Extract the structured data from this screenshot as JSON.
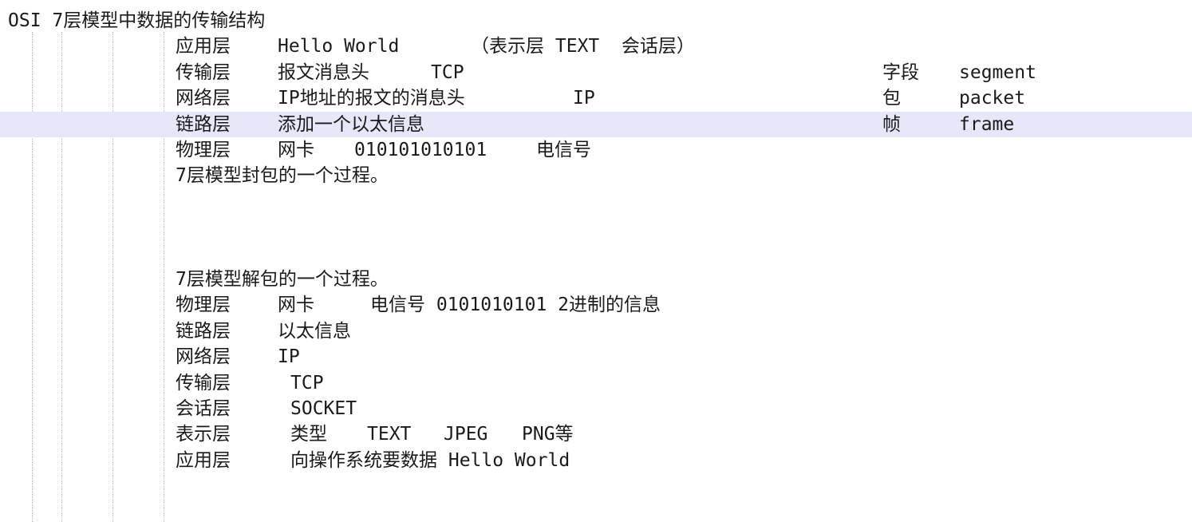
{
  "editor": {
    "title": "OSI 7层模型中数据的传输结构",
    "highlight_row": 4,
    "lines": [
      {
        "segments": [
          "OSI 7层模型中数据的传输结构"
        ]
      },
      {
        "segments": [
          "应用层",
          "Hello World",
          "（表示层 TEXT  会话层）"
        ]
      },
      {
        "segments": [
          "传输层",
          "报文消息头",
          "TCP",
          "字段",
          "segment"
        ]
      },
      {
        "segments": [
          "网络层",
          "IP地址的报文的消息头",
          "IP",
          "包",
          "packet"
        ]
      },
      {
        "segments": [
          "链路层",
          "添加一个以太信息",
          "帧",
          "frame"
        ]
      },
      {
        "segments": [
          "物理层",
          "网卡",
          "010101010101",
          "电信号"
        ]
      },
      {
        "segments": [
          "7层模型封包的一个过程。"
        ]
      },
      {
        "segments": []
      },
      {
        "segments": []
      },
      {
        "segments": []
      },
      {
        "segments": [
          "7层模型解包的一个过程。"
        ]
      },
      {
        "segments": [
          "物理层",
          "网卡",
          "电信号 0101010101 2进制的信息"
        ]
      },
      {
        "segments": [
          "链路层",
          "以太信息"
        ]
      },
      {
        "segments": [
          "网络层",
          "IP"
        ]
      },
      {
        "segments": [
          "传输层",
          "TCP"
        ]
      },
      {
        "segments": [
          "会话层",
          "SOCKET"
        ]
      },
      {
        "segments": [
          "表示层",
          "类型",
          "TEXT",
          "JPEG",
          "PNG等"
        ]
      },
      {
        "segments": [
          "应用层",
          "向操作系统要数据 Hello World"
        ]
      },
      {
        "segments": []
      },
      {
        "segments": []
      }
    ]
  }
}
